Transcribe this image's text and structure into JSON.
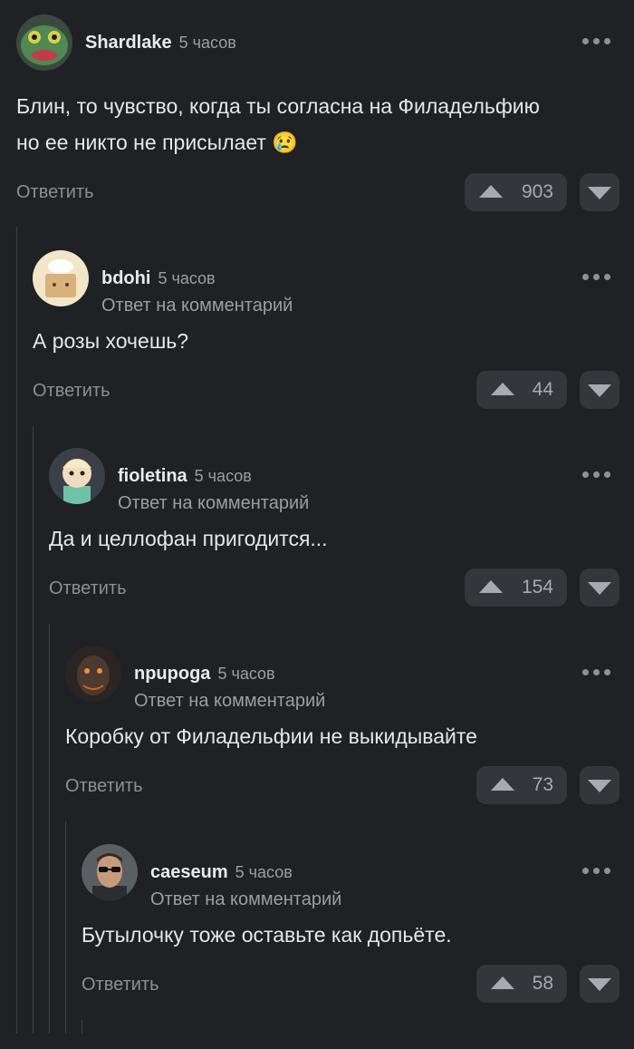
{
  "comments": [
    {
      "username": "Shardlake",
      "time": "5 часов",
      "reply_to": "",
      "text_lines": [
        "Блин, то чувство, когда ты согласна на Филадельфию",
        "но ее никто не присылает 😢"
      ],
      "reply_label": "Ответить",
      "votes": "903",
      "avatar": "frog-avatar"
    },
    {
      "username": "bdohi",
      "time": "5 часов",
      "reply_to": "Ответ на комментарий",
      "text_lines": [
        "А розы хочешь?"
      ],
      "reply_label": "Ответить",
      "votes": "44",
      "avatar": "chef-box-avatar"
    },
    {
      "username": "fioletina",
      "time": "5 часов",
      "reply_to": "Ответ на комментарий",
      "text_lines": [
        "Да и целлофан пригодится..."
      ],
      "reply_label": "Ответить",
      "votes": "154",
      "avatar": "cartoon-boy-avatar"
    },
    {
      "username": "npupoga",
      "time": "5 часов",
      "reply_to": "Ответ на комментарий",
      "text_lines": [
        "Коробку от Филадельфии не выкидывайте"
      ],
      "reply_label": "Ответить",
      "votes": "73",
      "avatar": "dark-creature-avatar"
    },
    {
      "username": "caeseum",
      "time": "5 часов",
      "reply_to": "Ответ на комментарий",
      "text_lines": [
        "Бутылочку тоже оставьте как допьёте."
      ],
      "reply_label": "Ответить",
      "votes": "58",
      "avatar": "man-sunglasses-avatar"
    }
  ]
}
